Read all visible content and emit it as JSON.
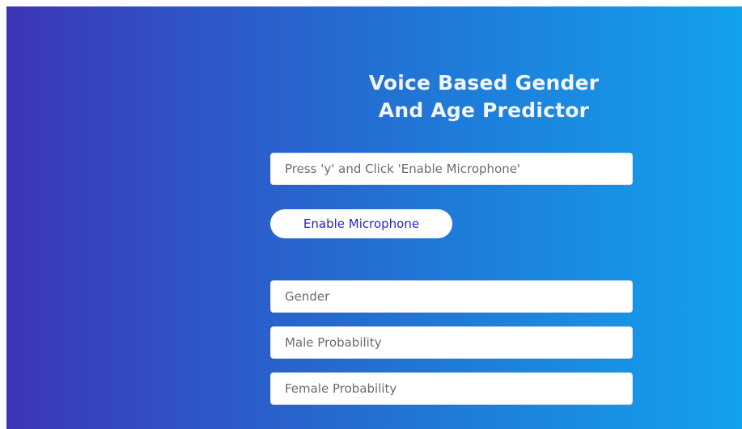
{
  "app": {
    "title_line1": "Voice Based Gender",
    "title_line2": "And Age Predictor"
  },
  "inputs": {
    "instruction_placeholder": "Press 'y' and Click 'Enable Microphone'",
    "gender_placeholder": "Gender",
    "male_probability_placeholder": "Male Probability",
    "female_probability_placeholder": "Female Probability"
  },
  "buttons": {
    "enable_microphone_label": "Enable Microphone"
  },
  "colors": {
    "gradient_start": "#3c35b5",
    "gradient_end": "#13a2ec",
    "button_text": "#2a22c9",
    "title_text": "#f2f4ff"
  }
}
